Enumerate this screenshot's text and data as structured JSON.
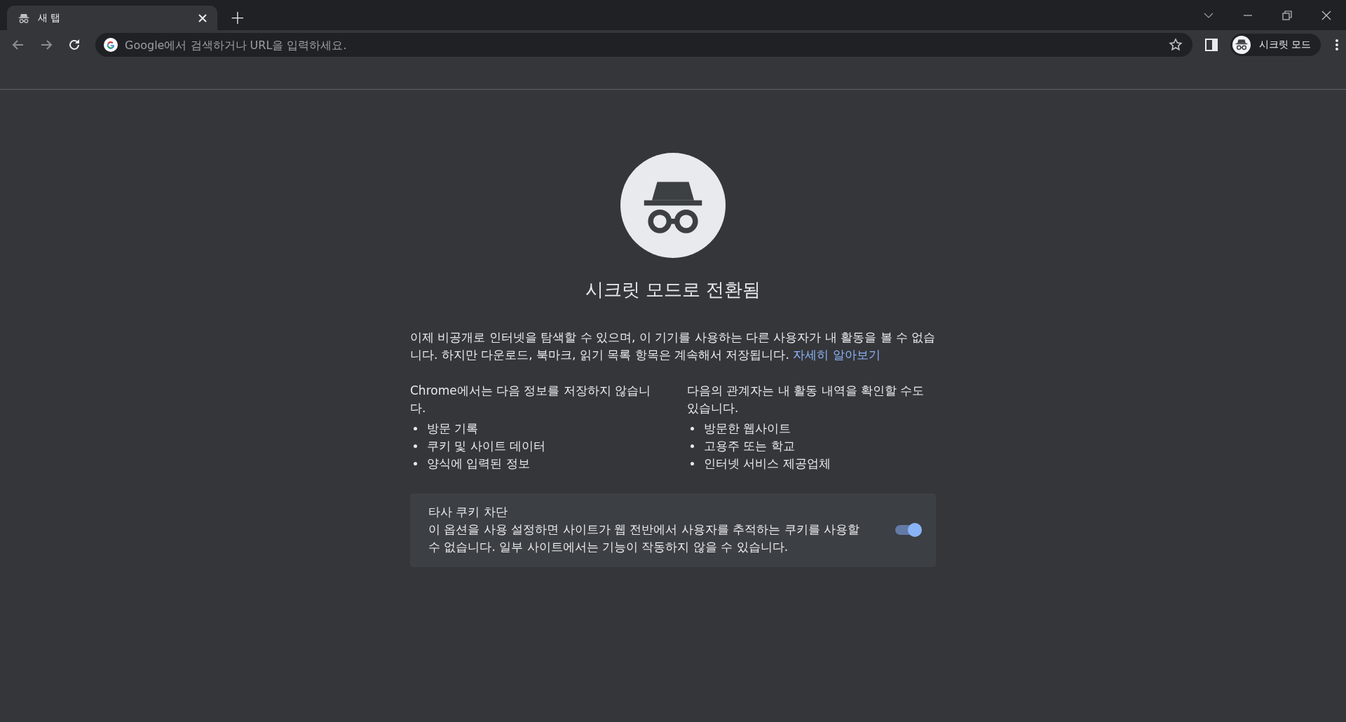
{
  "tabs": [
    {
      "title": "새 탭",
      "selected": true
    }
  ],
  "new_tab": {
    "label": "+"
  },
  "omnibox": {
    "placeholder": "Google에서 검색하거나 URL을 입력하세요."
  },
  "profile": {
    "label": "시크릿 모드"
  },
  "page": {
    "title": "시크릿 모드로 전환됨",
    "intro": "이제 비공개로 인터넷을 탐색할 수 있으며, 이 기기를 사용하는 다른 사용자가 내 활동을 볼 수 없습니다. 하지만 다운로드, 북마크, 읽기 목록 항목은 계속해서 저장됩니다.",
    "learn_more": "자세히 알아보기",
    "columns": [
      {
        "heading": "Chrome에서는 다음 정보를 저장하지 않습니다.",
        "items": [
          "방문 기록",
          "쿠키 및 사이트 데이터",
          "양식에 입력된 정보"
        ]
      },
      {
        "heading": "다음의 관계자는 내 활동 내역을 확인할 수도 있습니다.",
        "items": [
          "방문한 웹사이트",
          "고용주 또는 학교",
          "인터넷 서비스 제공업체"
        ]
      }
    ],
    "cookie_card": {
      "title": "타사 쿠키 차단",
      "description": "이 옵션을 사용 설정하면 사이트가 웹 전반에서 사용자를 추적하는 쿠키를 사용할 수 없습니다. 일부 사이트에서는 기능이 작동하지 않을 수 있습니다.",
      "on": true
    }
  }
}
